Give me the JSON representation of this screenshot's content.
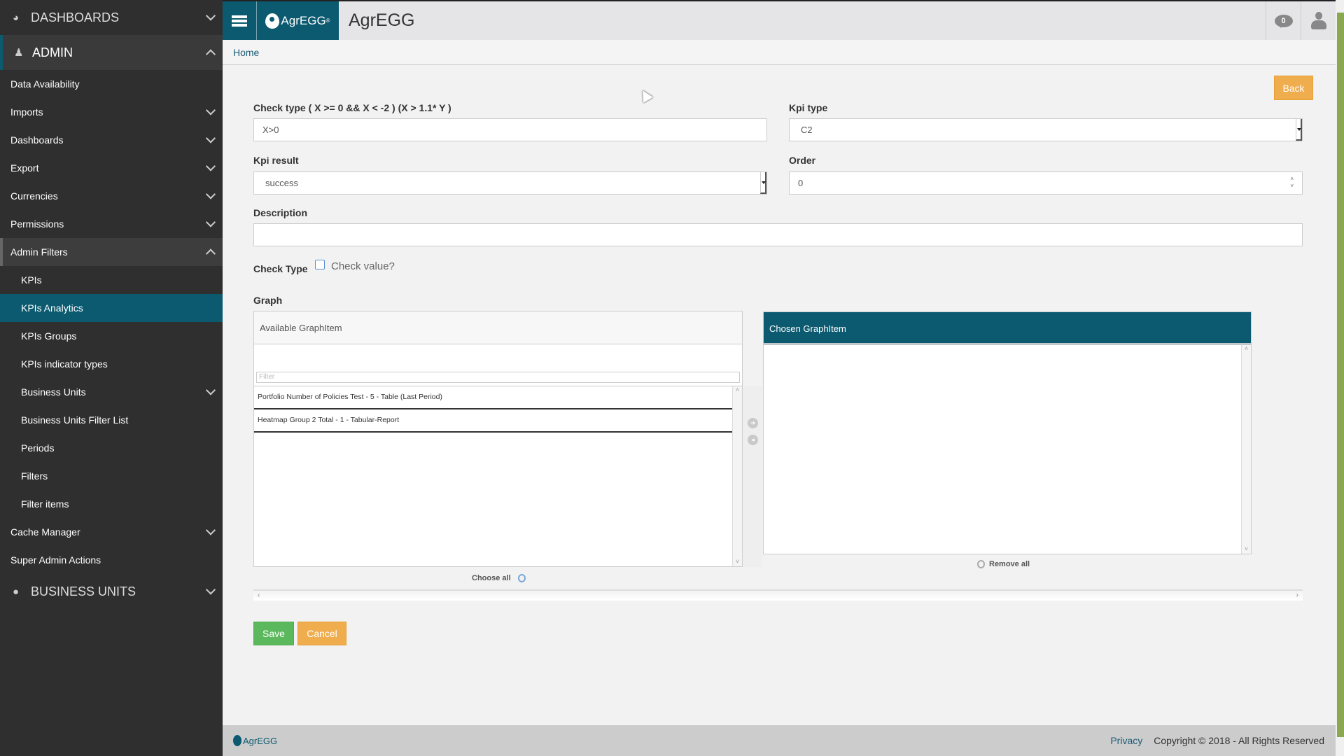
{
  "sidebar": {
    "sections": [
      {
        "label": "DASHBOARDS",
        "icon": "dashboard-icon"
      },
      {
        "label": "ADMIN",
        "icon": "user-plus-icon"
      },
      {
        "label": "BUSINESS UNITS",
        "icon": "globe-icon"
      }
    ],
    "items": [
      {
        "label": "Data Availability"
      },
      {
        "label": "Imports"
      },
      {
        "label": "Dashboards"
      },
      {
        "label": "Export"
      },
      {
        "label": "Currencies"
      },
      {
        "label": "Permissions"
      },
      {
        "label": "Admin Filters"
      },
      {
        "label": "KPIs"
      },
      {
        "label": "KPIs Analytics"
      },
      {
        "label": "KPIs Groups"
      },
      {
        "label": "KPIs indicator types"
      },
      {
        "label": "Business Units"
      },
      {
        "label": "Business Units Filter List"
      },
      {
        "label": "Periods"
      },
      {
        "label": "Filters"
      },
      {
        "label": "Filter items"
      },
      {
        "label": "Cache Manager"
      },
      {
        "label": "Super Admin Actions"
      }
    ]
  },
  "header": {
    "logo_text": "AgrEGG",
    "logo_reg": "®",
    "title": "AgrEGG",
    "notifications_count": "0"
  },
  "breadcrumb": {
    "home": "Home"
  },
  "form": {
    "back_label": "Back",
    "check_type_label": "Check type ( X >= 0 && X < -2 ) (X > 1.1* Y )",
    "check_type_value": "X>0",
    "kpi_type_label": "Kpi type",
    "kpi_type_value": "C2",
    "kpi_result_label": "Kpi result",
    "kpi_result_value": "success",
    "order_label": "Order",
    "order_value": "0",
    "description_label": "Description",
    "description_value": "",
    "check_type2_label": "Check Type",
    "check_value_label": "Check value?",
    "check_value_checked": false,
    "graph_label": "Graph",
    "available_header": "Available GraphItem",
    "filter_placeholder": "Filter",
    "available_items": [
      "Portfolio Number of Policies Test - 5 - Table (Last Period)",
      "Heatmap Group 2 Total - 1 - Tabular-Report"
    ],
    "chosen_header": "Chosen GraphItem",
    "chosen_items": [],
    "choose_all": "Choose all",
    "remove_all": "Remove all",
    "save_label": "Save",
    "cancel_label": "Cancel"
  },
  "footer": {
    "logo_text": "AgrEGG",
    "privacy": "Privacy",
    "copyright": "Copyright © 2018 - All Rights Reserved"
  },
  "colors": {
    "brand": "#0b5a70",
    "save": "#5cb85c",
    "warning": "#f0ad4e",
    "sidebar": "#2f2f2f"
  }
}
